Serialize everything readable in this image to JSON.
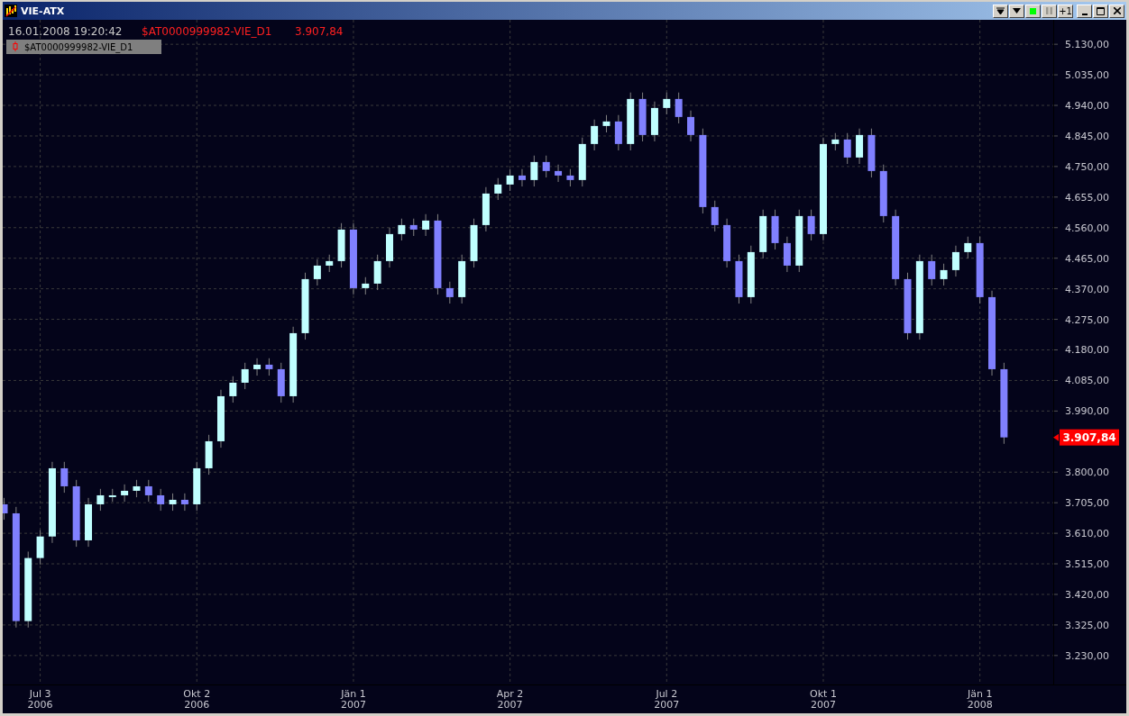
{
  "window": {
    "title": "VIE-ATX",
    "buttons": [
      {
        "kind": "scroll-end"
      },
      {
        "kind": "scroll"
      },
      {
        "kind": "live",
        "on": true
      },
      {
        "kind": "pause",
        "disabled": true
      },
      {
        "kind": "text",
        "label": "+1"
      },
      {
        "kind": "minimize"
      },
      {
        "kind": "maximize"
      },
      {
        "kind": "close"
      }
    ]
  },
  "header": {
    "timestamp": "16.01.2008 19:20:42",
    "symbol": "$AT0000999982-VIE_D1",
    "last_price": "3.907,84"
  },
  "price_marker": "3.907,84",
  "chart_data": {
    "type": "candlestick",
    "grid": true,
    "ylim": [
      3140,
      5206
    ],
    "categories": [
      null,
      null,
      null,
      "Jul 3\n2006",
      null,
      null,
      null,
      null,
      null,
      null,
      null,
      null,
      null,
      null,
      null,
      null,
      "Okt 2\n2006",
      null,
      null,
      null,
      null,
      null,
      null,
      null,
      null,
      null,
      null,
      null,
      null,
      "Jän 1\n2007",
      null,
      null,
      null,
      null,
      null,
      null,
      null,
      null,
      null,
      null,
      null,
      null,
      "Apr 2\n2007",
      null,
      null,
      null,
      null,
      null,
      null,
      null,
      null,
      null,
      null,
      null,
      null,
      "Jul 2\n2007",
      null,
      null,
      null,
      null,
      null,
      null,
      null,
      null,
      null,
      null,
      null,
      null,
      "Okt 1\n2007",
      null,
      null,
      null,
      null,
      null,
      null,
      null,
      null,
      null,
      null,
      null,
      null,
      "Jän 1\n2008",
      null,
      null
    ],
    "series": [
      {
        "name": "$AT0000999982-VIE_D1",
        "colors": [
          "#8080ff",
          "#8080ff",
          "#c0ffff",
          "#c0ffff",
          "#c0ffff",
          "#8080ff",
          "#8080ff",
          "#c0ffff",
          "#c0ffff",
          "#c0ffff",
          "#c0ffff",
          "#c0ffff",
          "#8080ff",
          "#8080ff",
          "#c0ffff",
          "#8080ff",
          "#c0ffff",
          "#c0ffff",
          "#c0ffff",
          "#c0ffff",
          "#c0ffff",
          "#c0ffff",
          "#8080ff",
          "#8080ff",
          "#c0ffff",
          "#c0ffff",
          "#c0ffff",
          "#c0ffff",
          "#c0ffff",
          "#8080ff",
          "#c0ffff",
          "#c0ffff",
          "#c0ffff",
          "#c0ffff",
          "#8080ff",
          "#c0ffff",
          "#8080ff",
          "#8080ff",
          "#c0ffff",
          "#c0ffff",
          "#c0ffff",
          "#c0ffff",
          "#c0ffff",
          "#8080ff",
          "#c0ffff",
          "#8080ff",
          "#8080ff",
          "#8080ff",
          "#c0ffff",
          "#c0ffff",
          "#c0ffff",
          "#8080ff",
          "#c0ffff",
          "#8080ff",
          "#c0ffff",
          "#c0ffff",
          "#8080ff",
          "#8080ff",
          "#8080ff",
          "#8080ff",
          "#8080ff",
          "#8080ff",
          "#c0ffff",
          "#c0ffff",
          "#8080ff",
          "#8080ff",
          "#c0ffff",
          "#8080ff",
          "#c0ffff",
          "#c0ffff",
          "#8080ff",
          "#c0ffff",
          "#8080ff",
          "#8080ff",
          "#8080ff",
          "#8080ff",
          "#c0ffff",
          "#8080ff",
          "#c0ffff",
          "#c0ffff",
          "#c0ffff",
          "#8080ff",
          "#8080ff",
          "#8080ff"
        ],
        "ohlc": [
          [
            3700,
            3720,
            3652,
            3672
          ],
          [
            3672,
            3692,
            3317,
            3337
          ],
          [
            3337,
            3553,
            3317,
            3533
          ],
          [
            3533,
            3620,
            3513,
            3600
          ],
          [
            3600,
            3832,
            3580,
            3812
          ],
          [
            3812,
            3832,
            3736,
            3756
          ],
          [
            3756,
            3776,
            3568,
            3588
          ],
          [
            3588,
            3720,
            3568,
            3700
          ],
          [
            3700,
            3748,
            3680,
            3728
          ],
          [
            3728,
            3748,
            3708,
            3728
          ],
          [
            3728,
            3762,
            3708,
            3742
          ],
          [
            3742,
            3776,
            3722,
            3756
          ],
          [
            3756,
            3776,
            3708,
            3728
          ],
          [
            3728,
            3748,
            3680,
            3700
          ],
          [
            3700,
            3734,
            3680,
            3714
          ],
          [
            3714,
            3734,
            3680,
            3700
          ],
          [
            3700,
            3832,
            3680,
            3812
          ],
          [
            3812,
            3916,
            3792,
            3896
          ],
          [
            3896,
            4056,
            3876,
            4036
          ],
          [
            4036,
            4098,
            4016,
            4078
          ],
          [
            4078,
            4140,
            4058,
            4120
          ],
          [
            4120,
            4154,
            4100,
            4134
          ],
          [
            4134,
            4154,
            4100,
            4120
          ],
          [
            4120,
            4140,
            4016,
            4036
          ],
          [
            4036,
            4252,
            4016,
            4232
          ],
          [
            4232,
            4420,
            4212,
            4400
          ],
          [
            4400,
            4462,
            4380,
            4442
          ],
          [
            4442,
            4476,
            4422,
            4456
          ],
          [
            4456,
            4574,
            4436,
            4554
          ],
          [
            4554,
            4574,
            4352,
            4372
          ],
          [
            4372,
            4406,
            4352,
            4386
          ],
          [
            4386,
            4476,
            4366,
            4456
          ],
          [
            4456,
            4560,
            4436,
            4540
          ],
          [
            4540,
            4588,
            4520,
            4568
          ],
          [
            4568,
            4588,
            4534,
            4554
          ],
          [
            4554,
            4602,
            4534,
            4582
          ],
          [
            4582,
            4602,
            4352,
            4372
          ],
          [
            4372,
            4392,
            4324,
            4344
          ],
          [
            4344,
            4476,
            4324,
            4456
          ],
          [
            4456,
            4588,
            4436,
            4568
          ],
          [
            4568,
            4686,
            4548,
            4666
          ],
          [
            4666,
            4714,
            4646,
            4694
          ],
          [
            4694,
            4742,
            4674,
            4722
          ],
          [
            4722,
            4742,
            4688,
            4708
          ],
          [
            4708,
            4784,
            4688,
            4764
          ],
          [
            4764,
            4784,
            4716,
            4736
          ],
          [
            4736,
            4756,
            4702,
            4722
          ],
          [
            4722,
            4742,
            4688,
            4708
          ],
          [
            4708,
            4840,
            4688,
            4820
          ],
          [
            4820,
            4896,
            4800,
            4876
          ],
          [
            4876,
            4910,
            4856,
            4890
          ],
          [
            4890,
            4910,
            4800,
            4820
          ],
          [
            4820,
            4980,
            4800,
            4960
          ],
          [
            4960,
            4980,
            4828,
            4848
          ],
          [
            4848,
            4952,
            4828,
            4932
          ],
          [
            4932,
            4980,
            4912,
            4960
          ],
          [
            4960,
            4980,
            4884,
            4904
          ],
          [
            4904,
            4924,
            4828,
            4848
          ],
          [
            4848,
            4868,
            4604,
            4624
          ],
          [
            4624,
            4644,
            4548,
            4568
          ],
          [
            4568,
            4588,
            4436,
            4456
          ],
          [
            4456,
            4476,
            4324,
            4344
          ],
          [
            4344,
            4504,
            4324,
            4484
          ],
          [
            4484,
            4616,
            4464,
            4596
          ],
          [
            4596,
            4616,
            4492,
            4512
          ],
          [
            4512,
            4532,
            4422,
            4442
          ],
          [
            4442,
            4616,
            4422,
            4596
          ],
          [
            4596,
            4616,
            4520,
            4540
          ],
          [
            4540,
            4840,
            4520,
            4820
          ],
          [
            4820,
            4854,
            4800,
            4834
          ],
          [
            4834,
            4854,
            4758,
            4778
          ],
          [
            4778,
            4868,
            4758,
            4848
          ],
          [
            4848,
            4868,
            4716,
            4736
          ],
          [
            4736,
            4756,
            4576,
            4596
          ],
          [
            4596,
            4616,
            4380,
            4400
          ],
          [
            4400,
            4420,
            4212,
            4232
          ],
          [
            4232,
            4476,
            4212,
            4456
          ],
          [
            4456,
            4476,
            4380,
            4400
          ],
          [
            4400,
            4448,
            4380,
            4428
          ],
          [
            4428,
            4504,
            4408,
            4484
          ],
          [
            4484,
            4532,
            4464,
            4512
          ],
          [
            4512,
            4532,
            4324,
            4344
          ],
          [
            4344,
            4364,
            4100,
            4120
          ],
          [
            4120,
            4140,
            3888,
            3908
          ]
        ]
      }
    ],
    "yticks": [
      {
        "value": 5130,
        "label": "5.130,00"
      },
      {
        "value": 5035,
        "label": "5.035,00"
      },
      {
        "value": 4940,
        "label": "4.940,00"
      },
      {
        "value": 4845,
        "label": "4.845,00"
      },
      {
        "value": 4750,
        "label": "4.750,00"
      },
      {
        "value": 4655,
        "label": "4.655,00"
      },
      {
        "value": 4560,
        "label": "4.560,00"
      },
      {
        "value": 4465,
        "label": "4.465,00"
      },
      {
        "value": 4370,
        "label": "4.370,00"
      },
      {
        "value": 4275,
        "label": "4.275,00"
      },
      {
        "value": 4180,
        "label": "4.180,00"
      },
      {
        "value": 4085,
        "label": "4.085,00"
      },
      {
        "value": 3990,
        "label": "3.990,00"
      },
      {
        "value": 3800,
        "label": "3.800,00"
      },
      {
        "value": 3705,
        "label": "3.705,00"
      },
      {
        "value": 3610,
        "label": "3.610,00"
      },
      {
        "value": 3515,
        "label": "3.515,00"
      },
      {
        "value": 3420,
        "label": "3.420,00"
      },
      {
        "value": 3325,
        "label": "3.325,00"
      },
      {
        "value": 3230,
        "label": "3.230,00"
      }
    ]
  }
}
